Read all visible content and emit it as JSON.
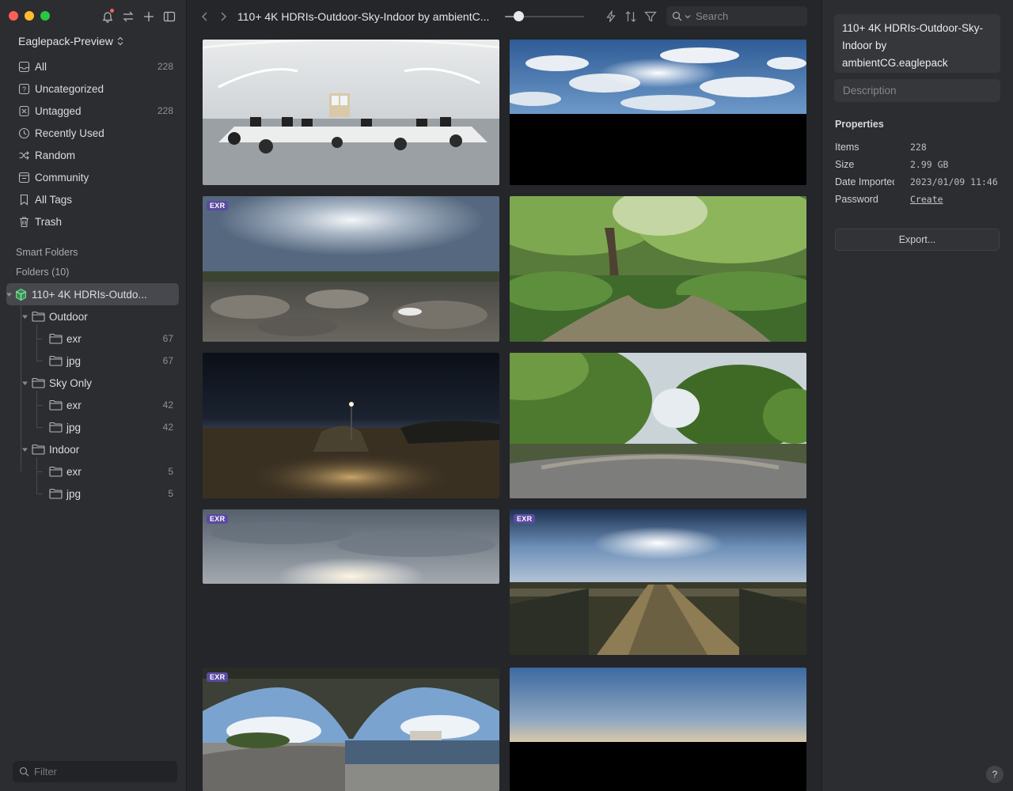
{
  "library": {
    "name": "Eaglepack-Preview"
  },
  "nav": [
    {
      "label": "All",
      "count": "228",
      "icon": "inbox-icon"
    },
    {
      "label": "Uncategorized",
      "count": "",
      "icon": "question-box-icon"
    },
    {
      "label": "Untagged",
      "count": "228",
      "icon": "tag-off-icon"
    },
    {
      "label": "Recently Used",
      "count": "",
      "icon": "clock-icon"
    },
    {
      "label": "Random",
      "count": "",
      "icon": "shuffle-icon"
    },
    {
      "label": "Community",
      "count": "",
      "icon": "community-icon"
    },
    {
      "label": "All Tags",
      "count": "",
      "icon": "bookmark-icon"
    },
    {
      "label": "Trash",
      "count": "",
      "icon": "trash-icon"
    }
  ],
  "sections": {
    "smart_folders": "Smart Folders",
    "folders": "Folders (10)"
  },
  "tree": {
    "root": "110+ 4K HDRIs-Outdo...",
    "groups": [
      {
        "label": "Outdoor",
        "children": [
          {
            "label": "exr",
            "count": "67"
          },
          {
            "label": "jpg",
            "count": "67"
          }
        ]
      },
      {
        "label": "Sky Only",
        "children": [
          {
            "label": "exr",
            "count": "42"
          },
          {
            "label": "jpg",
            "count": "42"
          }
        ]
      },
      {
        "label": "Indoor",
        "children": [
          {
            "label": "exr",
            "count": "5"
          },
          {
            "label": "jpg",
            "count": "5"
          }
        ]
      }
    ]
  },
  "filter": {
    "placeholder": "Filter"
  },
  "toolbar": {
    "title": "110+ 4K HDRIs-Outdoor-Sky-Indoor by ambientC...",
    "search_placeholder": "Search",
    "zoom": 0.17
  },
  "thumbnails": [
    {
      "scene": "office",
      "badge": ""
    },
    {
      "scene": "sky-clouds",
      "badge": ""
    },
    {
      "scene": "rocky-overcast",
      "badge": "EXR"
    },
    {
      "scene": "forest",
      "badge": ""
    },
    {
      "scene": "night-road",
      "badge": ""
    },
    {
      "scene": "green-park",
      "badge": ""
    },
    {
      "scene": "grey-sky",
      "badge": "EXR"
    },
    {
      "scene": "field-sunset",
      "badge": "EXR"
    },
    {
      "scene": "bridge",
      "badge": "EXR"
    },
    {
      "scene": "dusk-sky",
      "badge": ""
    }
  ],
  "inspector": {
    "name": "110+ 4K HDRIs-Outdoor-Sky-Indoor by ambientCG.eaglepack",
    "description_placeholder": "Description",
    "properties_title": "Properties",
    "properties": [
      {
        "key": "Items",
        "value": "228"
      },
      {
        "key": "Size",
        "value": "2.99 GB"
      },
      {
        "key": "Date Imported",
        "value": "2023/01/09 11:46"
      },
      {
        "key": "Password",
        "value": "Create"
      }
    ],
    "export_label": "Export...",
    "help_label": "?"
  },
  "colors": {
    "accent_cube": "#4cc36b",
    "badge": "#5b4aa0",
    "selected_row": "#46484d"
  }
}
